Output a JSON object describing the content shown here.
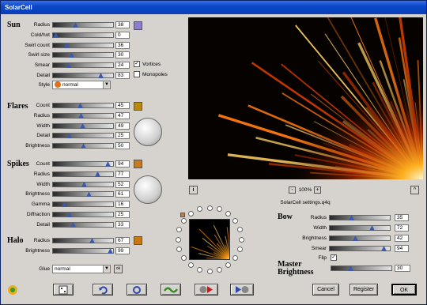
{
  "window": {
    "title": "SolarCell"
  },
  "sun": {
    "heading": "Sun",
    "color": "#8a7fc8",
    "rows": [
      {
        "label": "Radius",
        "value": "38",
        "level": 0.35
      },
      {
        "label": "Cold/hot",
        "value": "0",
        "level": 0.0
      },
      {
        "label": "Swirl count",
        "value": "36",
        "level": 0.2
      },
      {
        "label": "Swirl size",
        "value": "30",
        "level": 0.28
      },
      {
        "label": "Smear",
        "value": "24",
        "level": 0.23
      },
      {
        "label": "Detail",
        "value": "83",
        "level": 0.82
      }
    ],
    "vortices_label": "Vortices",
    "vortices_checked": true,
    "monopoles_label": "Monopoles",
    "monopoles_checked": false,
    "style_label": "Style",
    "style_value": "normal"
  },
  "flares": {
    "heading": "Flares",
    "color": "#b88a10",
    "rows": [
      {
        "label": "Count",
        "value": "45",
        "level": 0.44
      },
      {
        "label": "Radius",
        "value": "47",
        "level": 0.46
      },
      {
        "label": "Width",
        "value": "49",
        "level": 0.48
      },
      {
        "label": "Detail",
        "value": "25",
        "level": 0.24
      },
      {
        "label": "Brightness",
        "value": "50",
        "level": 0.5
      }
    ]
  },
  "spikes": {
    "heading": "Spikes",
    "color": "#c87a20",
    "rows": [
      {
        "label": "Count",
        "value": "94",
        "level": 0.94
      },
      {
        "label": "Radius",
        "value": "77",
        "level": 0.76
      },
      {
        "label": "Width",
        "value": "52",
        "level": 0.51
      },
      {
        "label": "Brightness",
        "value": "61",
        "level": 0.6
      },
      {
        "label": "Gamma",
        "value": "16",
        "level": 0.15
      },
      {
        "label": "Diffraction",
        "value": "25",
        "level": 0.24
      },
      {
        "label": "Detail",
        "value": "33",
        "level": 0.32
      }
    ]
  },
  "halo": {
    "heading": "Halo",
    "color": "#c87a10",
    "rows": [
      {
        "label": "Radius",
        "value": "67",
        "level": 0.66
      },
      {
        "label": "Brightness",
        "value": "99",
        "level": 0.98
      }
    ]
  },
  "glue": {
    "label": "Glue",
    "value": "normal",
    "side_button": "ok"
  },
  "preview": {
    "info_button": "i",
    "zoom_minus": "-",
    "zoom_value": "100%",
    "zoom_plus": "+",
    "corner_button": "^",
    "settings_file": "SolarCell settings.q4q"
  },
  "bow": {
    "heading": "Bow",
    "rows": [
      {
        "label": "Radius",
        "value": "35",
        "level": 0.34
      },
      {
        "label": "Width",
        "value": "72",
        "level": 0.71
      },
      {
        "label": "Brightness",
        "value": "42",
        "level": 0.41
      },
      {
        "label": "Smear",
        "value": "94",
        "level": 0.93
      }
    ],
    "flip_label": "Flip",
    "flip_checked": true
  },
  "master": {
    "heading_line1": "Master",
    "heading_line2": "Brightness",
    "value": "30",
    "level": 0.3
  },
  "buttons": {
    "cancel": "Cancel",
    "register": "Register",
    "ok": "OK"
  },
  "glyphs": {
    "check": "✓",
    "dd_arrow": "▼"
  }
}
